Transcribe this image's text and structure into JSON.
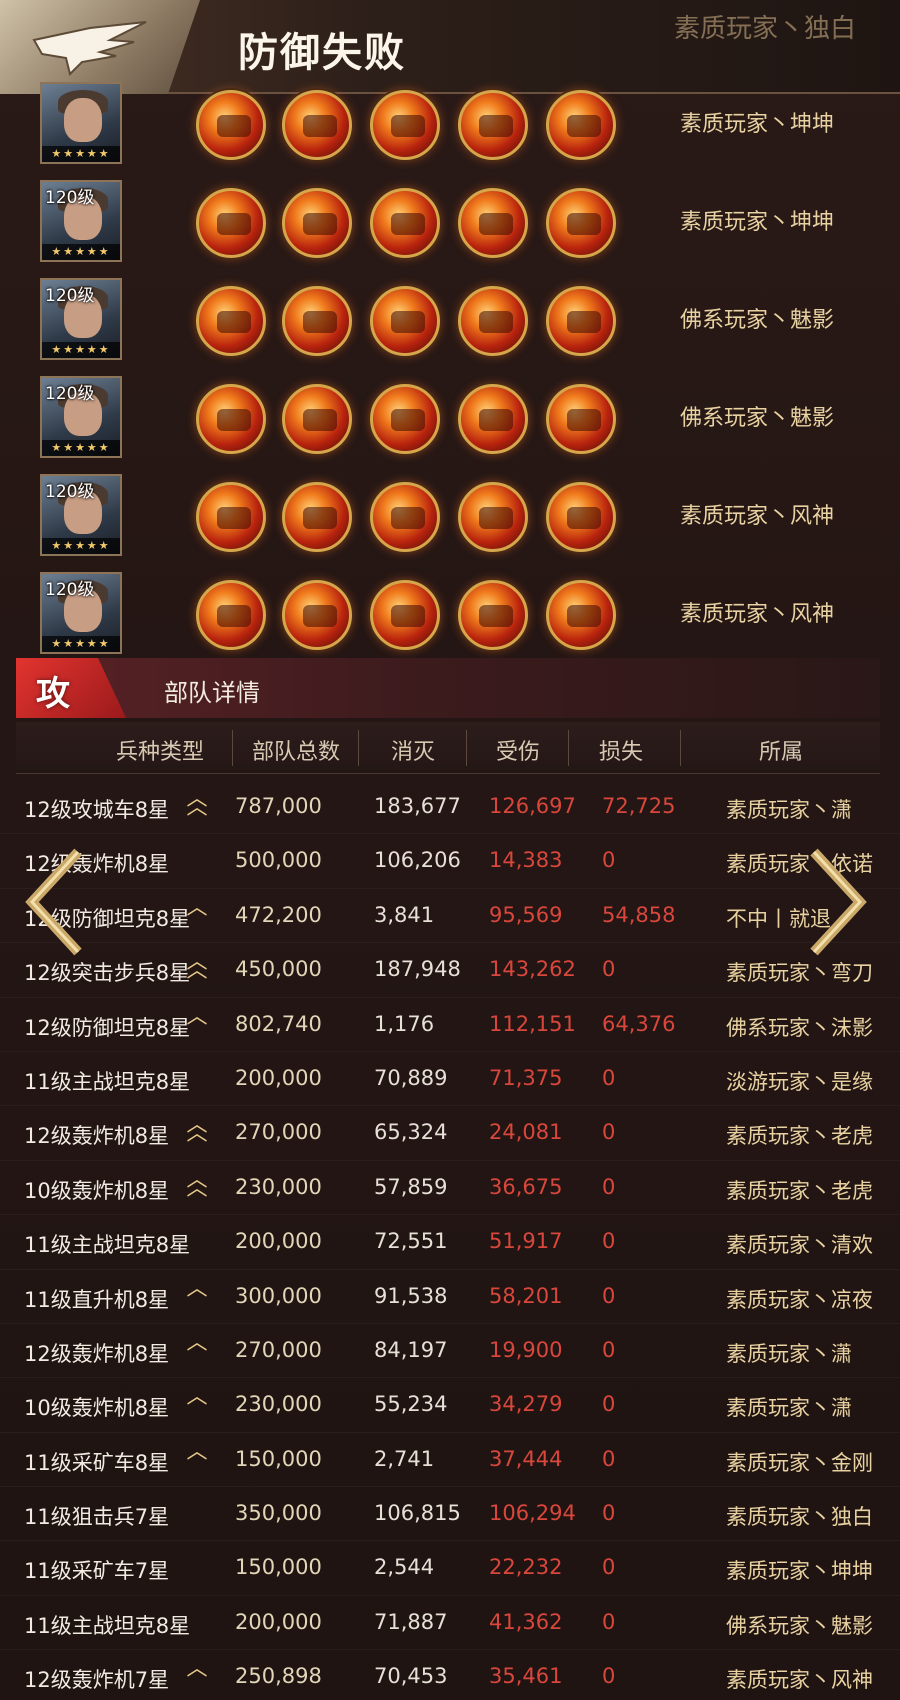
{
  "banner": {
    "title": "防御失败",
    "ghost_owner": "素质玩家丶独白"
  },
  "skill_rows": [
    {
      "level": "",
      "owner": "素质玩家丶坤坤",
      "stars": "★★★★★"
    },
    {
      "level": "120级",
      "owner": "素质玩家丶坤坤",
      "stars": "★★★★★"
    },
    {
      "level": "120级",
      "owner": "佛系玩家丶魅影",
      "stars": "★★★★★"
    },
    {
      "level": "120级",
      "owner": "佛系玩家丶魅影",
      "stars": "★★★★★"
    },
    {
      "level": "120级",
      "owner": "素质玩家丶风神",
      "stars": "★★★★★"
    },
    {
      "level": "120级",
      "owner": "素质玩家丶风神",
      "stars": "★★★★★"
    }
  ],
  "section": {
    "badge": "攻",
    "title": "部队详情"
  },
  "columns": {
    "type": "兵种类型",
    "total": "部队总数",
    "kill": "消灭",
    "hurt": "受伤",
    "lost": "损失",
    "owner": "所属"
  },
  "units": [
    {
      "type": "12级攻城车8星",
      "rank": "double",
      "total": "787,000",
      "kill": "183,677",
      "hurt": "126,697",
      "lost": "72,725",
      "owner": "素质玩家丶潇"
    },
    {
      "type": "12级轰炸机8星",
      "rank": "",
      "total": "500,000",
      "kill": "106,206",
      "hurt": "14,383",
      "lost": "0",
      "owner": "素质玩家丶依诺"
    },
    {
      "type": "12级防御坦克8星",
      "rank": "single",
      "total": "472,200",
      "kill": "3,841",
      "hurt": "95,569",
      "lost": "54,858",
      "owner": "不中丨就退"
    },
    {
      "type": "12级突击步兵8星",
      "rank": "double",
      "total": "450,000",
      "kill": "187,948",
      "hurt": "143,262",
      "lost": "0",
      "owner": "素质玩家丶弯刀"
    },
    {
      "type": "12级防御坦克8星",
      "rank": "single",
      "total": "802,740",
      "kill": "1,176",
      "hurt": "112,151",
      "lost": "64,376",
      "owner": "佛系玩家丶沫影"
    },
    {
      "type": "11级主战坦克8星",
      "rank": "",
      "total": "200,000",
      "kill": "70,889",
      "hurt": "71,375",
      "lost": "0",
      "owner": "淡游玩家丶是缘"
    },
    {
      "type": "12级轰炸机8星",
      "rank": "double",
      "total": "270,000",
      "kill": "65,324",
      "hurt": "24,081",
      "lost": "0",
      "owner": "素质玩家丶老虎"
    },
    {
      "type": "10级轰炸机8星",
      "rank": "double",
      "total": "230,000",
      "kill": "57,859",
      "hurt": "36,675",
      "lost": "0",
      "owner": "素质玩家丶老虎"
    },
    {
      "type": "11级主战坦克8星",
      "rank": "",
      "total": "200,000",
      "kill": "72,551",
      "hurt": "51,917",
      "lost": "0",
      "owner": "素质玩家丶清欢"
    },
    {
      "type": "11级直升机8星",
      "rank": "single",
      "total": "300,000",
      "kill": "91,538",
      "hurt": "58,201",
      "lost": "0",
      "owner": "素质玩家丶凉夜"
    },
    {
      "type": "12级轰炸机8星",
      "rank": "single",
      "total": "270,000",
      "kill": "84,197",
      "hurt": "19,900",
      "lost": "0",
      "owner": "素质玩家丶潇"
    },
    {
      "type": "10级轰炸机8星",
      "rank": "single",
      "total": "230,000",
      "kill": "55,234",
      "hurt": "34,279",
      "lost": "0",
      "owner": "素质玩家丶潇"
    },
    {
      "type": "11级采矿车8星",
      "rank": "single",
      "total": "150,000",
      "kill": "2,741",
      "hurt": "37,444",
      "lost": "0",
      "owner": "素质玩家丶金刚"
    },
    {
      "type": "11级狙击兵7星",
      "rank": "",
      "total": "350,000",
      "kill": "106,815",
      "hurt": "106,294",
      "lost": "0",
      "owner": "素质玩家丶独白"
    },
    {
      "type": "11级采矿车7星",
      "rank": "",
      "total": "150,000",
      "kill": "2,544",
      "hurt": "22,232",
      "lost": "0",
      "owner": "素质玩家丶坤坤"
    },
    {
      "type": "11级主战坦克8星",
      "rank": "",
      "total": "200,000",
      "kill": "71,887",
      "hurt": "41,362",
      "lost": "0",
      "owner": "佛系玩家丶魅影"
    },
    {
      "type": "12级轰炸机7星",
      "rank": "single",
      "total": "250,898",
      "kill": "70,453",
      "hurt": "35,461",
      "lost": "0",
      "owner": "素质玩家丶风神"
    }
  ],
  "icons": {
    "emblem": "eagle-icon",
    "prev": "chevron-left-icon",
    "next": "chevron-right-icon",
    "rank_single": "rank-chevron-icon",
    "rank_double": "rank-double-chevron-icon"
  },
  "colors": {
    "damage": "#d9473c",
    "gold_text": "#e9d2a2",
    "attack_badge": "#e2342f"
  }
}
